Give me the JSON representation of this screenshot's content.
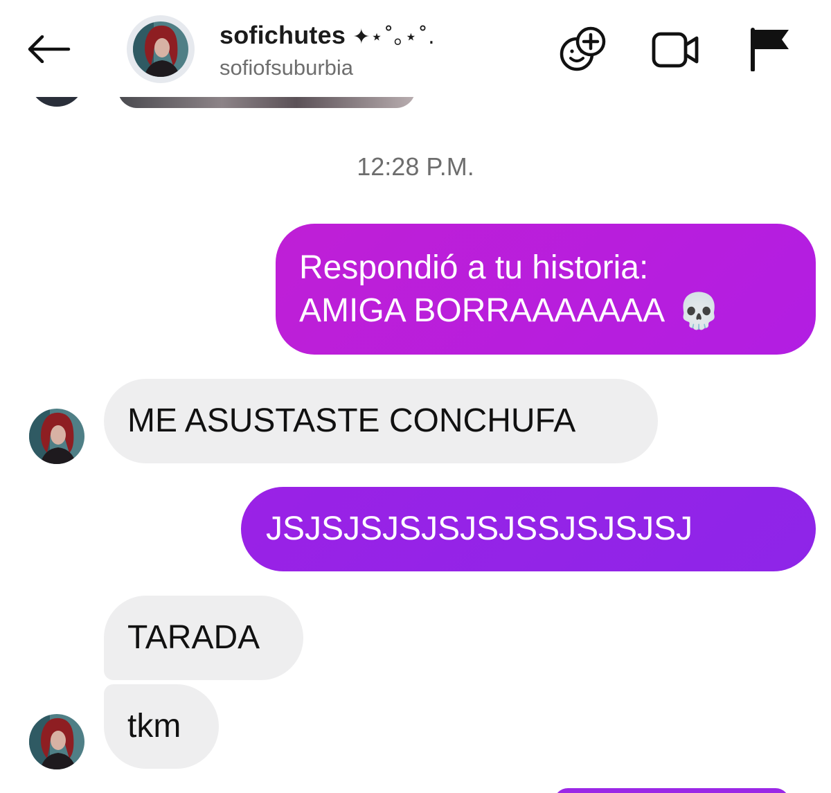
{
  "header": {
    "display_name": "sofichutes",
    "name_decoration": "✦⋆˚｡⋆˚.",
    "username": "sofiofsuburbia",
    "icons": {
      "back": "arrow-left-icon",
      "effects": "face-plus-icon",
      "video": "video-camera-icon",
      "report": "flag-icon"
    }
  },
  "timestamp": "12:28 P.M.",
  "messages": [
    {
      "from": "me",
      "line1": "Respondió a tu historia:",
      "line2": "AMIGA BORRAAAAAAA",
      "emoji": "💀"
    },
    {
      "from": "them",
      "text": "ME ASUSTASTE CONCHUFA"
    },
    {
      "from": "me",
      "text": "JSJSJSJSJSJSJSSJSJSJSJ"
    },
    {
      "from": "them",
      "text": "TARADA"
    },
    {
      "from": "them",
      "text": "tkm"
    }
  ],
  "colors": {
    "outgoing_pink": "#bf1fd6",
    "outgoing_purple": "#9a22e6",
    "incoming_gray": "#eeeeef",
    "secondary_text": "#6e6e6e"
  }
}
